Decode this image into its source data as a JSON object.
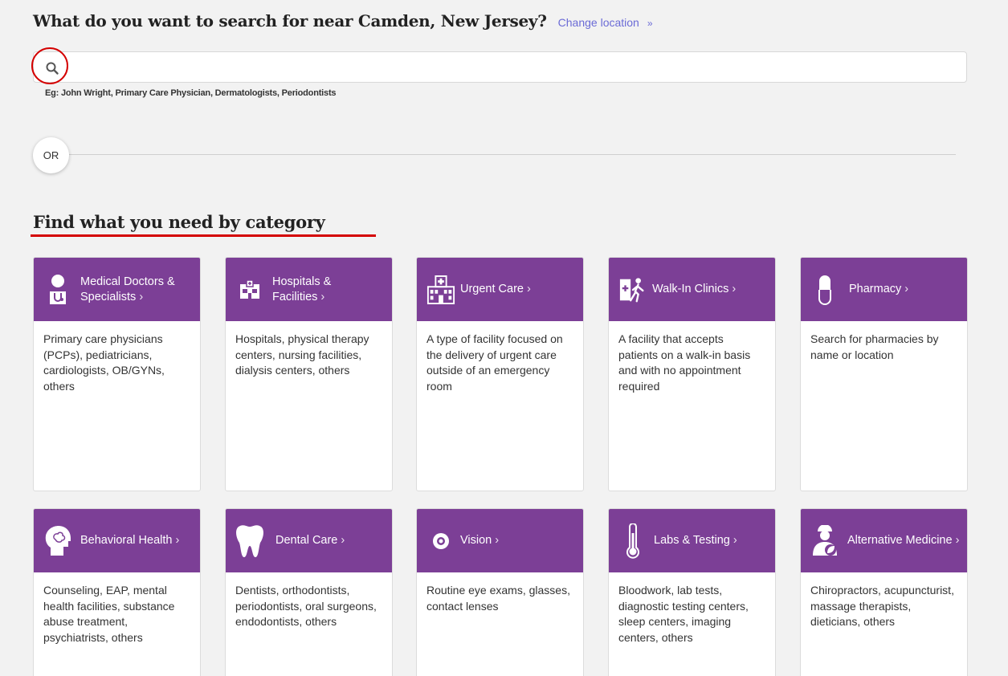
{
  "search": {
    "heading": "What do you want to search for near Camden, New Jersey?",
    "change_location": "Change location",
    "change_location_arrow": "»",
    "value": "",
    "placeholder": "",
    "example": "Eg: John Wright, Primary Care Physician, Dermatologists, Periodontists"
  },
  "or_label": "OR",
  "categories_heading": "Find what you need by category",
  "colors": {
    "accent": "#7c3f96",
    "annotation": "#d40000",
    "link": "#6b6bd6"
  },
  "categories": [
    {
      "label": "Medical Doctors & Specialists",
      "icon": "doctor-icon",
      "description": "Primary care physicians (PCPs), pediatricians, cardiologists, OB/GYNs, others"
    },
    {
      "label": "Hospitals & Facilities",
      "icon": "hospital-icon",
      "description": "Hospitals, physical therapy centers, nursing facilities, dialysis centers, others"
    },
    {
      "label": "Urgent Care",
      "icon": "urgent-care-building-icon",
      "description": "A type of facility focused on the delivery of urgent care outside of an emergency room"
    },
    {
      "label": "Walk-In Clinics",
      "icon": "walk-in-person-icon",
      "description": "A facility that accepts patients on a walk-in basis and with no appointment required"
    },
    {
      "label": "Pharmacy",
      "icon": "pill-icon",
      "description": "Search for pharmacies by name or location"
    },
    {
      "label": "Behavioral Health",
      "icon": "head-profile-icon",
      "description": "Counseling, EAP, mental health facilities, substance abuse treatment, psychiatrists, others"
    },
    {
      "label": "Dental Care",
      "icon": "tooth-icon",
      "description": "Dentists, orthodontists, periodontists, oral surgeons, endodontists, others"
    },
    {
      "label": "Vision",
      "icon": "eye-icon",
      "description": "Routine eye exams, glasses, contact lenses"
    },
    {
      "label": "Labs & Testing",
      "icon": "thermometer-icon",
      "description": "Bloodwork, lab tests, diagnostic testing centers, sleep centers, imaging centers, others"
    },
    {
      "label": "Alternative Medicine",
      "icon": "practitioner-leaf-icon",
      "description": "Chiropractors, acupuncturist, massage therapists, dieticians, others"
    }
  ]
}
